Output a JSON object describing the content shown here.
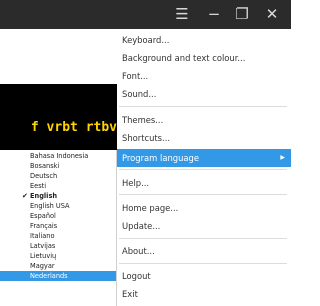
{
  "titlebar": {
    "icons": [
      "hamburger-menu-icon",
      "minimize-icon",
      "restore-icon",
      "close-icon"
    ]
  },
  "display": {
    "text": "f vrbt rtbv",
    "text_color": "#ffd400"
  },
  "menu": {
    "items": [
      {
        "label": "Keyboard..."
      },
      {
        "label": "Background and text colour..."
      },
      {
        "label": "Font..."
      },
      {
        "label": "Sound..."
      },
      {
        "label": "Themes..."
      },
      {
        "label": "Shortcuts..."
      },
      {
        "label": "Program language"
      },
      {
        "label": "Help..."
      },
      {
        "label": "Home page..."
      },
      {
        "label": "Update..."
      },
      {
        "label": "About..."
      },
      {
        "label": "Logout"
      },
      {
        "label": "Exit"
      }
    ]
  },
  "language_menu": {
    "items": [
      {
        "label": "Bahasa Indonesia"
      },
      {
        "label": "Bosanski"
      },
      {
        "label": "Deutsch"
      },
      {
        "label": "Eesti"
      },
      {
        "label": "English",
        "checked": true
      },
      {
        "label": "English USA"
      },
      {
        "label": "Español"
      },
      {
        "label": "Français"
      },
      {
        "label": "Italiano"
      },
      {
        "label": "Latvijas"
      },
      {
        "label": "Lietuvių"
      },
      {
        "label": "Magyar"
      },
      {
        "label": "Nederlands",
        "selected": true
      }
    ]
  },
  "colors": {
    "accent": "#3399e6",
    "titlebar": "#2b2b2b"
  }
}
